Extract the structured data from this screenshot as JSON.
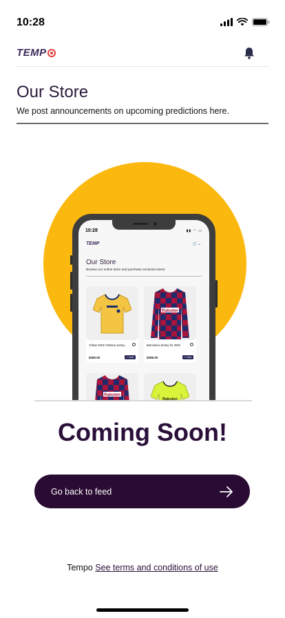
{
  "status_bar": {
    "time": "10:28"
  },
  "header": {
    "logo_text": "TEMP"
  },
  "page": {
    "title": "Our Store",
    "subtitle": "We post announcements on upcoming predictions here."
  },
  "mockup": {
    "time": "10:28",
    "logo_text": "TEMP",
    "title": "Our Store",
    "subtitle": "Browse our online store and purchase exclusive items",
    "products": [
      {
        "name": "Yellow 2019 Chelsea Jersey",
        "price": "$280.00",
        "cart_label": "+ Cart",
        "jersey": "yellow"
      },
      {
        "name": "Barcelona Jersey for 2020",
        "price": "$298.00",
        "cart_label": "+ Cart",
        "jersey": "barca"
      },
      {
        "name": "",
        "price": "",
        "cart_label": "",
        "jersey": "barca"
      },
      {
        "name": "",
        "price": "",
        "cart_label": "",
        "jersey": "neon"
      }
    ]
  },
  "coming_soon": "Coming Soon!",
  "cta": {
    "label": "Go back to feed",
    "icon": "arrow-right-icon"
  },
  "footer": {
    "prefix": "Tempo",
    "link": "See terms and conditions of use"
  },
  "colors": {
    "brand_dark": "#2a0b33",
    "accent_yellow": "#fbb80f",
    "brand_red": "#e23b3b"
  }
}
